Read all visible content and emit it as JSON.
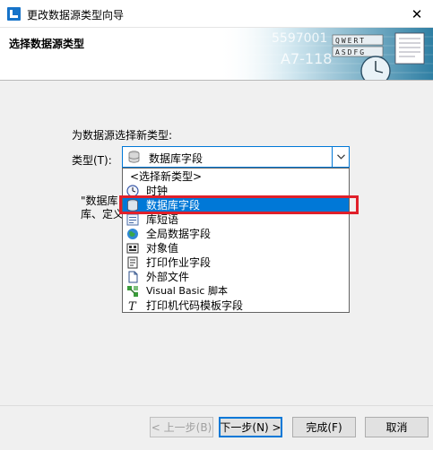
{
  "window": {
    "title": "更改数据源类型向导",
    "close_glyph": "✕"
  },
  "header": {
    "title": "选择数据源类型",
    "art_texts": [
      "5597001",
      "A7-118",
      "QWERT",
      "ASDFG"
    ]
  },
  "form": {
    "prompt": "为数据源选择新类型:",
    "type_label": "类型(T):",
    "combo_value": "数据库字段",
    "combo_icon": "database-icon",
    "hint_line1": "\"数据库",
    "hint_line2": "库、定义"
  },
  "dropdown": {
    "options": [
      {
        "label": "<选择新类型>",
        "icon": "",
        "selected": false
      },
      {
        "label": "时钟",
        "icon": "clock-icon",
        "selected": false
      },
      {
        "label": "数据库字段",
        "icon": "database-icon",
        "selected": true
      },
      {
        "label": "库短语",
        "icon": "phrase-icon",
        "selected": false
      },
      {
        "label": "全局数据字段",
        "icon": "globe-icon",
        "selected": false
      },
      {
        "label": "对象值",
        "icon": "object-icon",
        "selected": false
      },
      {
        "label": "打印作业字段",
        "icon": "print-job-icon",
        "selected": false
      },
      {
        "label": "外部文件",
        "icon": "file-icon",
        "selected": false
      },
      {
        "label": "Visual Basic 脚本",
        "icon": "vb-script-icon",
        "selected": false
      },
      {
        "label": "打印机代码模板字段",
        "icon": "printer-code-icon",
        "selected": false
      }
    ]
  },
  "buttons": {
    "back": "< 上一步(B)",
    "next": "下一步(N) >",
    "finish": "完成(F)",
    "cancel": "取消"
  },
  "colors": {
    "selection": "#0078d7",
    "highlight_border": "#e0202a"
  }
}
